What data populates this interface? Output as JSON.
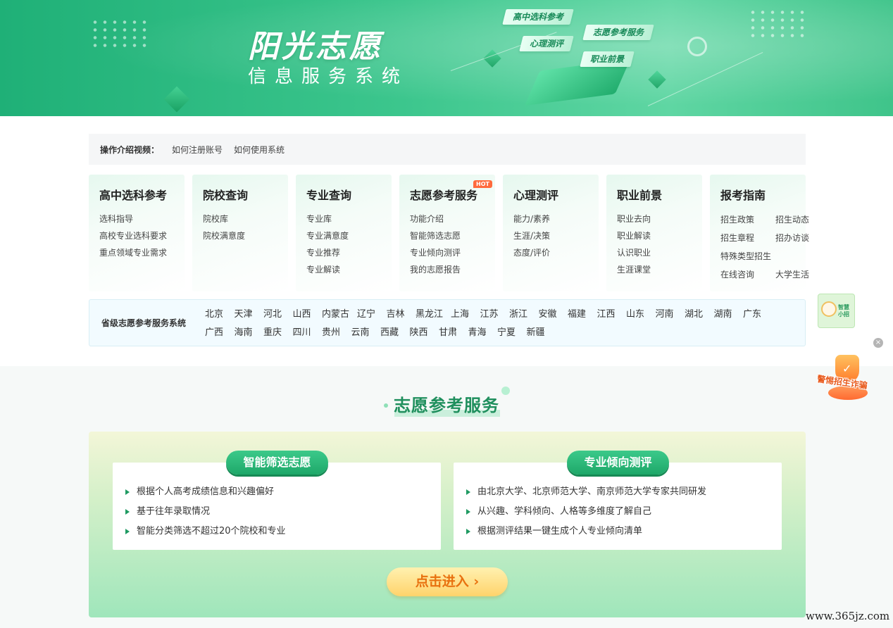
{
  "banner": {
    "title": "阳光志愿",
    "subtitle": "信息服务系统",
    "tags": [
      "高中选科参考",
      "心理测评",
      "志愿参考服务",
      "职业前景"
    ]
  },
  "op_bar": {
    "label": "操作介绍视频：",
    "links": [
      "如何注册账号",
      "如何使用系统"
    ]
  },
  "cards": [
    {
      "title": "高中选科参考",
      "links": [
        "选科指导",
        "高校专业选科要求",
        "重点领域专业需求"
      ]
    },
    {
      "title": "院校查询",
      "links": [
        "院校库",
        "院校满意度"
      ]
    },
    {
      "title": "专业查询",
      "links": [
        "专业库",
        "专业满意度",
        "专业推荐",
        "专业解读"
      ]
    },
    {
      "title": "志愿参考服务",
      "badge": "HOT",
      "links": [
        "功能介绍",
        "智能筛选志愿",
        "专业倾向测评",
        "我的志愿报告"
      ]
    },
    {
      "title": "心理测评",
      "links": [
        "能力/素养",
        "生涯/决策",
        "态度/评价"
      ]
    },
    {
      "title": "职业前景",
      "links": [
        "职业去向",
        "职业解读",
        "认识职业",
        "生涯课堂"
      ]
    },
    {
      "title": "报考指南",
      "links": [
        "招生政策",
        "招生动态",
        "招生章程",
        "招办访谈",
        "特殊类型招生",
        "",
        "在线咨询",
        "大学生活"
      ]
    }
  ],
  "provinces": {
    "label": "省级志愿参考服务系统",
    "items": [
      "北京",
      "天津",
      "河北",
      "山西",
      "内蒙古",
      "辽宁",
      "吉林",
      "黑龙江",
      "上海",
      "江苏",
      "浙江",
      "安徽",
      "福建",
      "江西",
      "山东",
      "河南",
      "湖北",
      "湖南",
      "广东",
      "广西",
      "海南",
      "重庆",
      "四川",
      "贵州",
      "云南",
      "西藏",
      "陕西",
      "甘肃",
      "青海",
      "宁夏",
      "新疆"
    ]
  },
  "service": {
    "section_title": "志愿参考服务",
    "left": {
      "title": "智能筛选志愿",
      "items": [
        "根据个人高考成绩信息和兴趣偏好",
        "基于往年录取情况",
        "智能分类筛选不超过20个院校和专业"
      ]
    },
    "right": {
      "title": "专业倾向测评",
      "items": [
        "由北京大学、北京师范大学、南京师范大学专家共同研发",
        "从兴趣、学科倾向、人格等多维度了解自己",
        "根据测评结果一键生成个人专业倾向清单"
      ]
    },
    "enter_label": "点击进入 ›"
  },
  "floating": {
    "helper_label": "智慧小招",
    "close_symbol": "×",
    "warning_label": "警惕招生诈骗"
  },
  "watermark": "www.365jz.com",
  "colors": {
    "brand_green": "#1fb077",
    "accent_orange": "#e8710f",
    "hot_badge": "#ff6a3d"
  }
}
